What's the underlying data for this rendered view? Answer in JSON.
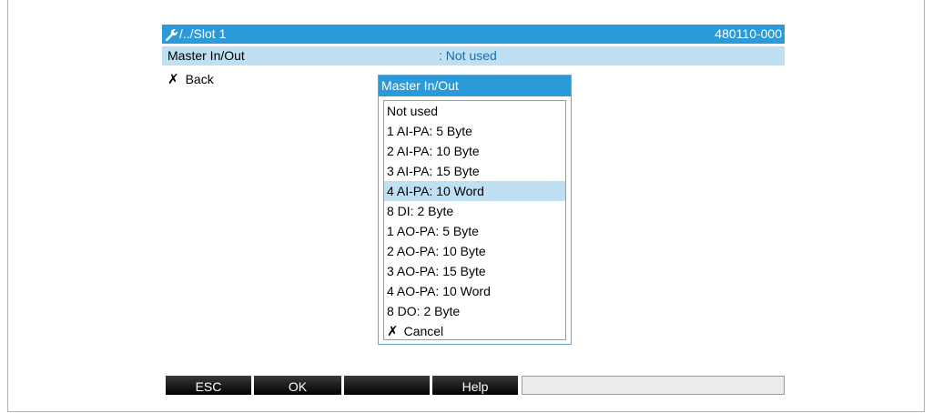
{
  "title_bar": {
    "path": "/../Slot 1",
    "device_code": "480110-000",
    "icon": "wrench-icon"
  },
  "parameter": {
    "label": "Master In/Out",
    "value": ": Not used"
  },
  "back_item": {
    "label": "Back",
    "icon": "x-icon"
  },
  "popup": {
    "title": "Master In/Out",
    "selected_index": 4,
    "options": [
      "Not used",
      "1 AI-PA: 5 Byte",
      "2 AI-PA: 10 Byte",
      "3 AI-PA: 15 Byte",
      "4 AI-PA: 10 Word",
      "8 DI: 2 Byte",
      "1 AO-PA: 5 Byte",
      "2 AO-PA: 10 Byte",
      "3 AO-PA: 15 Byte",
      "4 AO-PA: 10 Word",
      "8 DO: 2 Byte"
    ],
    "cancel_label": "Cancel"
  },
  "softkeys": {
    "key1": "ESC",
    "key2": "OK",
    "key3": "",
    "key4": "Help",
    "field": ""
  },
  "colors": {
    "title_blue": "#2a9ad8",
    "selection_light_blue": "#bfe0f3",
    "value_blue": "#0e6fb8"
  }
}
